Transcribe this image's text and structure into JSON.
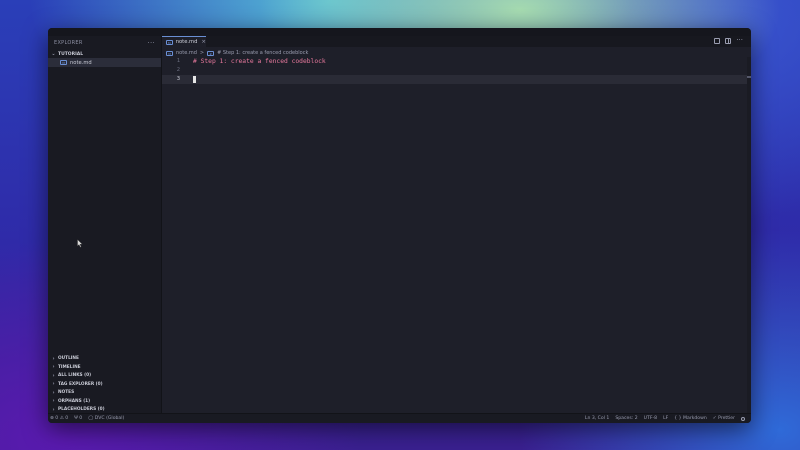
{
  "sidebar": {
    "header": "EXPLORER",
    "more": "···",
    "folder": "TUTORIAL",
    "file": "note.md",
    "panels": [
      "OUTLINE",
      "TIMELINE",
      "ALL LINKS (0)",
      "TAG EXPLORER (0)",
      "NOTES",
      "ORPHANS (1)",
      "PLACEHOLDERS (0)"
    ]
  },
  "tab": {
    "label": "note.md",
    "close": "×"
  },
  "tab_actions": {
    "more": "···"
  },
  "breadcrumb": {
    "file": "note.md",
    "separator": ">",
    "heading": "# Step 1: create a fenced codeblock"
  },
  "editor": {
    "lines": [
      {
        "number": "1",
        "text": "# Step 1: create a fenced codeblock"
      },
      {
        "number": "2",
        "text": ""
      },
      {
        "number": "3",
        "text": ""
      }
    ]
  },
  "status": {
    "problems": "⊗ 0 ⚠ 0",
    "ports": "Ψ 0",
    "dvc": "◯ DVC (Global)",
    "position": "Ln 3, Col 1",
    "spaces": "Spaces: 2",
    "encoding": "UTF-8",
    "eol": "LF",
    "language": "{ } Markdown",
    "formatter": "✓ Prettier"
  },
  "colors": {
    "editor_bg": "#1e1f29",
    "heading_text": "#e8799d",
    "accent": "#6a8fd4"
  }
}
